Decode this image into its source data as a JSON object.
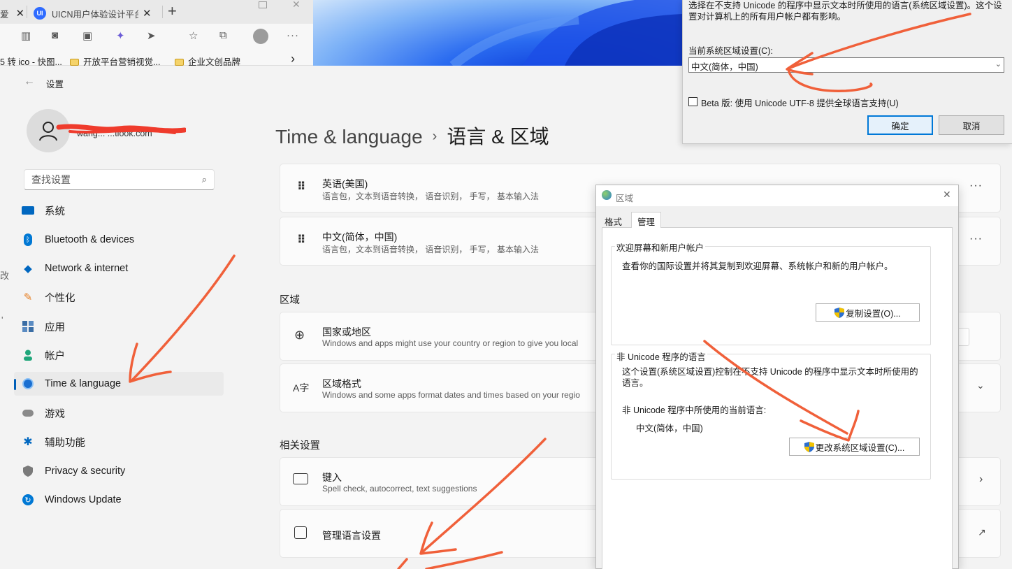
{
  "browser": {
    "tabs": [
      {
        "title": "爱",
        "icon": "page-icon"
      },
      {
        "title": "UICN用户体验设计平台",
        "icon": "uicn-logo-icon",
        "logo_text": "UI"
      }
    ],
    "new_tab": "+",
    "toolbar_icons": [
      "reader-icon",
      "camera-icon",
      "image-icon",
      "extension-icon",
      "cursor-icon",
      "favorites-star-icon",
      "collections-icon",
      "profile-icon",
      "more-icon"
    ],
    "favorites": [
      {
        "label": "5 转 ico - 快图...",
        "icon": "page-icon"
      },
      {
        "label": "开放平台营销视觉...",
        "icon": "folder-icon"
      },
      {
        "label": "企业文创品牌",
        "icon": "folder-icon"
      }
    ],
    "favorites_more": "›"
  },
  "settings": {
    "title": "设置",
    "email": "wang... ...tlook.com",
    "search_placeholder": "查找设置",
    "nav": [
      {
        "label": "系统",
        "icon": "monitor-icon",
        "color": "#0067c0"
      },
      {
        "label": "Bluetooth & devices",
        "icon": "bluetooth-icon",
        "color": "#0078d4"
      },
      {
        "label": "Network & internet",
        "icon": "wifi-icon",
        "color": "#0067c0"
      },
      {
        "label": "个性化",
        "icon": "brush-icon",
        "color": "#e67e22"
      },
      {
        "label": "应用",
        "icon": "apps-icon",
        "color": "#3b6ea5"
      },
      {
        "label": "帐户",
        "icon": "person-icon",
        "color": "#1fa67a"
      },
      {
        "label": "Time & language",
        "icon": "globe-clock-icon",
        "color": "#1a6fd1",
        "selected": true
      },
      {
        "label": "游戏",
        "icon": "gamepad-icon",
        "color": "#8a8a8a"
      },
      {
        "label": "辅助功能",
        "icon": "accessibility-icon",
        "color": "#0067c0"
      },
      {
        "label": "Privacy & security",
        "icon": "shield-icon",
        "color": "#7a7a7a"
      },
      {
        "label": "Windows Update",
        "icon": "update-icon",
        "color": "#0078d4"
      }
    ],
    "breadcrumb": {
      "parent": "Time & language",
      "separator": "›",
      "current": "语言 & 区域"
    },
    "languages": [
      {
        "name": "英语(美国)",
        "features": "语言包，文本到语音转换， 语音识别， 手写， 基本输入法"
      },
      {
        "name": "中文(简体，中国)",
        "features": "语言包，文本到语音转换， 语音识别， 手写， 基本输入法"
      }
    ],
    "region_section": "区域",
    "country": {
      "title": "国家或地区",
      "desc": "Windows and apps might use your country or region to give you local"
    },
    "regional_format": {
      "title": "区域格式",
      "desc": "Windows and some apps format dates and times based on your regio"
    },
    "related_section": "相关设置",
    "typing": {
      "title": "键入",
      "desc": "Spell check, autocorrect, text suggestions"
    },
    "admin_lang": {
      "title": "管理语言设置"
    },
    "left_edge_fragments": [
      "改",
      "'"
    ]
  },
  "locale_dialog": {
    "desc": "选择在不支持 Unicode 的程序中显示文本时所使用的语言(系统区域设置)。这个设置对计算机上的所有用户帐户都有影响。",
    "current_label": "当前系统区域设置(C):",
    "current_value": "中文(简体，中国)",
    "beta_label": "Beta 版: 使用 Unicode UTF-8 提供全球语言支持(U)",
    "beta_checked": false,
    "ok": "确定",
    "cancel": "取消"
  },
  "region_dialog": {
    "title": "区域",
    "tabs": [
      "格式",
      "管理"
    ],
    "active_tab": "管理",
    "welcome_group": "欢迎屏幕和新用户帐户",
    "welcome_desc": "查看你的国际设置并将其复制到欢迎屏幕、系统帐户和新的用户帐户。",
    "copy_button": "复制设置(O)...",
    "nonunicode_group": "非 Unicode 程序的语言",
    "nonunicode_desc": "这个设置(系统区域设置)控制在不支持 Unicode 的程序中显示文本时所使用的语言。",
    "current_lang_label": "非 Unicode 程序中所使用的当前语言:",
    "current_lang_value": "中文(简体，中国)",
    "change_button": "更改系统区域设置(C)..."
  },
  "accent_colors": {
    "annotation": "#f0603a",
    "selection": "#005fb8",
    "redaction": "#ef3b2c"
  }
}
